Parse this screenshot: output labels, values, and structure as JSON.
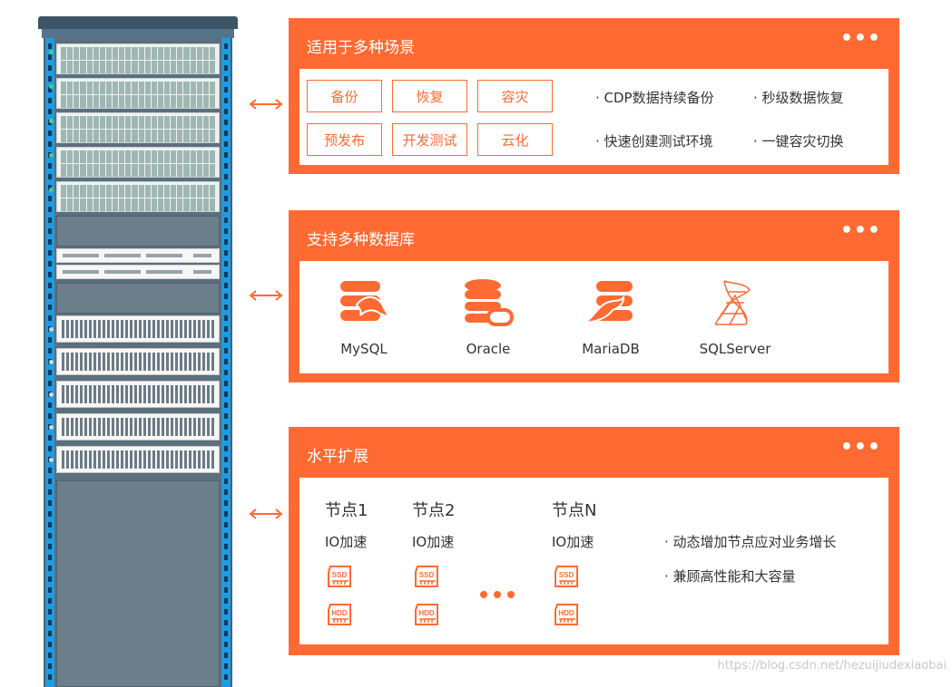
{
  "panels": {
    "scenarios": {
      "title": "适用于多种场景",
      "more": "•••",
      "tags": [
        "备份",
        "恢复",
        "容灾",
        "预发布",
        "开发测试",
        "云化"
      ],
      "bullets": [
        "· CDP数据持续备份",
        "· 秒级数据恢复",
        "· 快速创建测试环境",
        "· 一键容灾切换"
      ]
    },
    "databases": {
      "title": "支持多种数据库",
      "more": "•••",
      "items": [
        {
          "label": "MySQL",
          "icon": "mysql-icon"
        },
        {
          "label": "Oracle",
          "icon": "oracle-icon"
        },
        {
          "label": "MariaDB",
          "icon": "mariadb-icon"
        },
        {
          "label": "SQLServer",
          "icon": "sqlserver-icon"
        }
      ]
    },
    "scaling": {
      "title": "水平扩展",
      "more": "•••",
      "nodes": [
        {
          "title": "节点1",
          "io": "IO加速",
          "disks": [
            "SSD",
            "HDD"
          ]
        },
        {
          "title": "节点2",
          "io": "IO加速",
          "disks": [
            "SSD",
            "HDD"
          ]
        },
        {
          "title": "节点N",
          "io": "IO加速",
          "disks": [
            "SSD",
            "HDD"
          ]
        }
      ],
      "bullets": [
        "· 动态增加节点应对业务增长",
        "· 兼顾高性能和大容量"
      ]
    }
  },
  "watermark": "https://blog.csdn.net/hezuijiudexiaobai",
  "colors": {
    "accent": "#ff6a33",
    "rack": "#4a6273",
    "rail": "#1e9be3"
  }
}
